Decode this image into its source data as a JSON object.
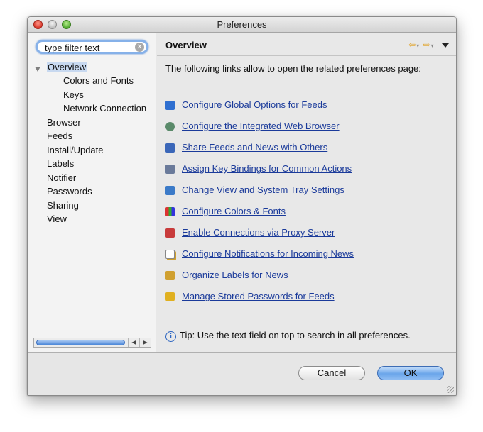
{
  "window": {
    "title": "Preferences"
  },
  "search": {
    "value": "type filter text"
  },
  "tree": {
    "items": [
      {
        "label": "Overview",
        "selected": true
      },
      {
        "label": "Colors and Fonts"
      },
      {
        "label": "Keys"
      },
      {
        "label": "Network Connection"
      },
      {
        "label": "Browser"
      },
      {
        "label": "Feeds"
      },
      {
        "label": "Install/Update"
      },
      {
        "label": "Labels"
      },
      {
        "label": "Notifier"
      },
      {
        "label": "Passwords"
      },
      {
        "label": "Sharing"
      },
      {
        "label": "View"
      }
    ]
  },
  "panel": {
    "title": "Overview",
    "intro": "The following links allow to open the related preferences page:",
    "links": [
      {
        "label": "Configure Global Options for Feeds",
        "icon": "rss-icon",
        "color": "#2f6fd0"
      },
      {
        "label": "Configure the Integrated Web Browser",
        "icon": "globe-icon",
        "color": "#5a8a6a"
      },
      {
        "label": "Share Feeds and News with Others",
        "icon": "people-icon",
        "color": "#3a66b8"
      },
      {
        "label": "Assign Key Bindings for Common Actions",
        "icon": "keyboard-icon",
        "color": "#6a7a9a"
      },
      {
        "label": "Change View and System Tray Settings",
        "icon": "window-icon",
        "color": "#3b7ac8"
      },
      {
        "label": "Configure Colors & Fonts",
        "icon": "palette-icon",
        "color": "#d08a20"
      },
      {
        "label": "Enable Connections via Proxy Server",
        "icon": "network-icon",
        "color": "#c83b3b"
      },
      {
        "label": "Configure Notifications for Incoming News",
        "icon": "notification-icon",
        "color": "#d0a030"
      },
      {
        "label": "Organize Labels for News",
        "icon": "label-icon",
        "color": "#d0a030"
      },
      {
        "label": "Manage Stored Passwords for Feeds",
        "icon": "lock-icon",
        "color": "#e0b020"
      }
    ],
    "tip": "Tip: Use the text field on top to search in all preferences."
  },
  "buttons": {
    "cancel": "Cancel",
    "ok": "OK"
  }
}
